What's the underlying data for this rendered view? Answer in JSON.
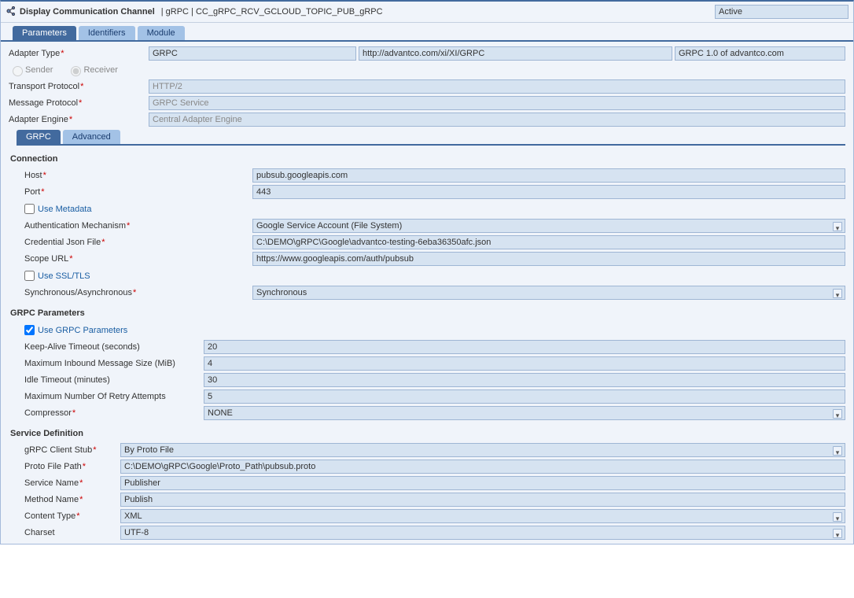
{
  "header": {
    "title": "Display Communication Channel",
    "path": "| gRPC | CC_gRPC_RCV_GCLOUD_TOPIC_PUB_gRPC",
    "status": "Active"
  },
  "tabs": {
    "parameters": "Parameters",
    "identifiers": "Identifiers",
    "module": "Module"
  },
  "adapter": {
    "type_label": "Adapter Type",
    "type_value": "GRPC",
    "namespace": "http://advantco.com/xi/XI/GRPC",
    "version": "GRPC 1.0 of advantco.com",
    "sender_label": "Sender",
    "receiver_label": "Receiver",
    "transport_label": "Transport Protocol",
    "transport_value": "HTTP/2",
    "message_label": "Message Protocol",
    "message_value": "GRPC Service",
    "engine_label": "Adapter Engine",
    "engine_value": "Central Adapter Engine"
  },
  "sub_tabs": {
    "grpc": "GRPC",
    "advanced": "Advanced"
  },
  "conn": {
    "section": "Connection",
    "host_label": "Host",
    "host_value": "pubsub.googleapis.com",
    "port_label": "Port",
    "port_value": "443",
    "metadata_label": "Use Metadata",
    "auth_label": "Authentication Mechanism",
    "auth_value": "Google Service Account (File System)",
    "cred_label": "Credential Json File",
    "cred_value": "C:\\DEMO\\gRPC\\Google\\advantco-testing-6eba36350afc.json",
    "scope_label": "Scope URL",
    "scope_value": "https://www.googleapis.com/auth/pubsub",
    "ssl_label": "Use SSL/TLS",
    "sync_label": "Synchronous/Asynchronous",
    "sync_value": "Synchronous"
  },
  "grpc": {
    "section": "GRPC Parameters",
    "use_label": "Use GRPC Parameters",
    "keep_label": "Keep-Alive Timeout (seconds)",
    "keep_value": "20",
    "max_label": "Maximum Inbound Message Size (MiB)",
    "max_value": "4",
    "idle_label": "Idle Timeout (minutes)",
    "idle_value": "30",
    "retry_label": "Maximum Number Of Retry Attempts",
    "retry_value": "5",
    "comp_label": "Compressor",
    "comp_value": "NONE"
  },
  "svc": {
    "section": "Service Definition",
    "stub_label": "gRPC Client Stub",
    "stub_value": "By Proto File",
    "proto_label": "Proto File Path",
    "proto_value": "C:\\DEMO\\gRPC\\Google\\Proto_Path\\pubsub.proto",
    "svc_label": "Service Name",
    "svc_value": "Publisher",
    "method_label": "Method Name",
    "method_value": "Publish",
    "ct_label": "Content Type",
    "ct_value": "XML",
    "charset_label": "Charset",
    "charset_value": "UTF-8"
  }
}
